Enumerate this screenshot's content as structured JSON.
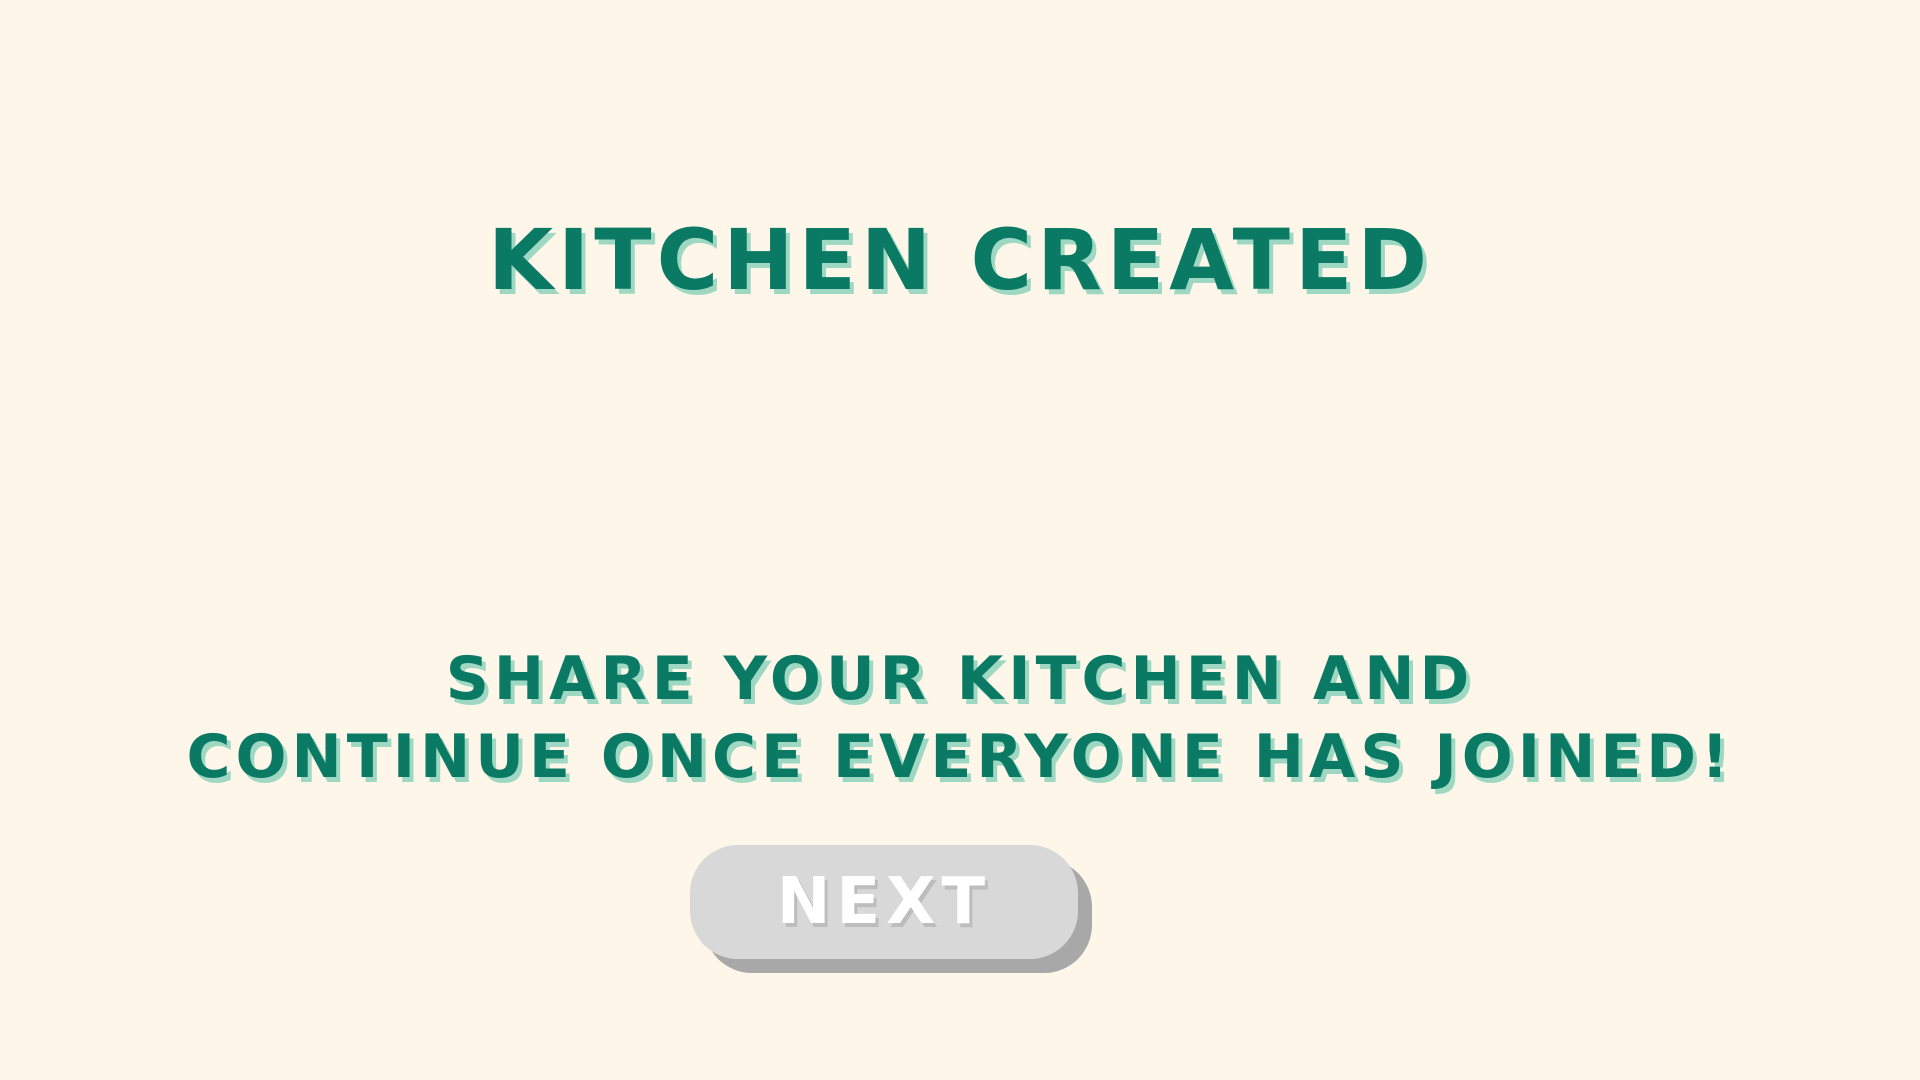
{
  "screen": {
    "title": "KITCHEN CREATED",
    "message_lines": [
      "SHARE YOUR KITCHEN AND",
      "CONTINUE ONCE EVERYONE HAS JOINED!"
    ],
    "next_button_label": "NEXT"
  },
  "colors": {
    "background": "#FDF6E9",
    "text_primary": "#0B7A65",
    "text_shadow": "#9FD8C2",
    "button_disabled": "#D8D8D8",
    "button_shadow": "#A8A8A8",
    "button_text": "#FFFFFF"
  }
}
